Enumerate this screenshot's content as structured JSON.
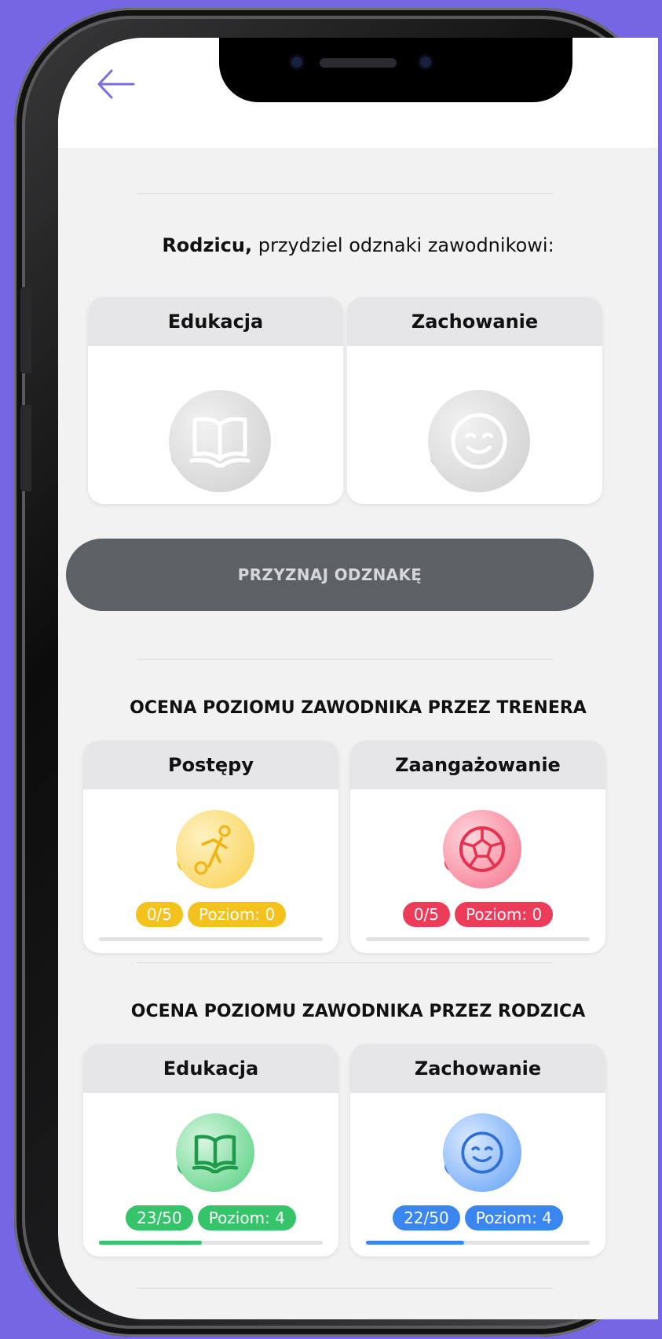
{
  "prompt": {
    "bold": "Rodzicu,",
    "rest": " przydziel odznaki zawodnikowi:"
  },
  "assign_cards": [
    {
      "title": "Edukacja",
      "icon": "book-icon"
    },
    {
      "title": "Zachowanie",
      "icon": "smile-icon"
    }
  ],
  "cta_label": "PRZYZNAJ ODZNAKĘ",
  "coach_section": {
    "title": "OCENA POZIOMU ZAWODNIKA PRZEZ TRENERA",
    "cards": [
      {
        "title": "Postępy",
        "icon": "player-kicking-icon",
        "count": "0/5",
        "level": "Poziom: 0",
        "progress": 0,
        "color": "#f3c21c"
      },
      {
        "title": "Zaangażowanie",
        "icon": "soccer-ball-icon",
        "count": "0/5",
        "level": "Poziom: 0",
        "progress": 0,
        "color": "#ec3c59"
      }
    ]
  },
  "parent_section": {
    "title": "OCENA POZIOMU ZAWODNIKA PRZEZ RODZICA",
    "cards": [
      {
        "title": "Edukacja",
        "icon": "book-icon",
        "count": "23/50",
        "level": "Poziom: 4",
        "progress": 0.46,
        "color": "#35c46a"
      },
      {
        "title": "Zachowanie",
        "icon": "smile-icon",
        "count": "22/50",
        "level": "Poziom: 4",
        "progress": 0.44,
        "color": "#3b86ee"
      }
    ]
  }
}
